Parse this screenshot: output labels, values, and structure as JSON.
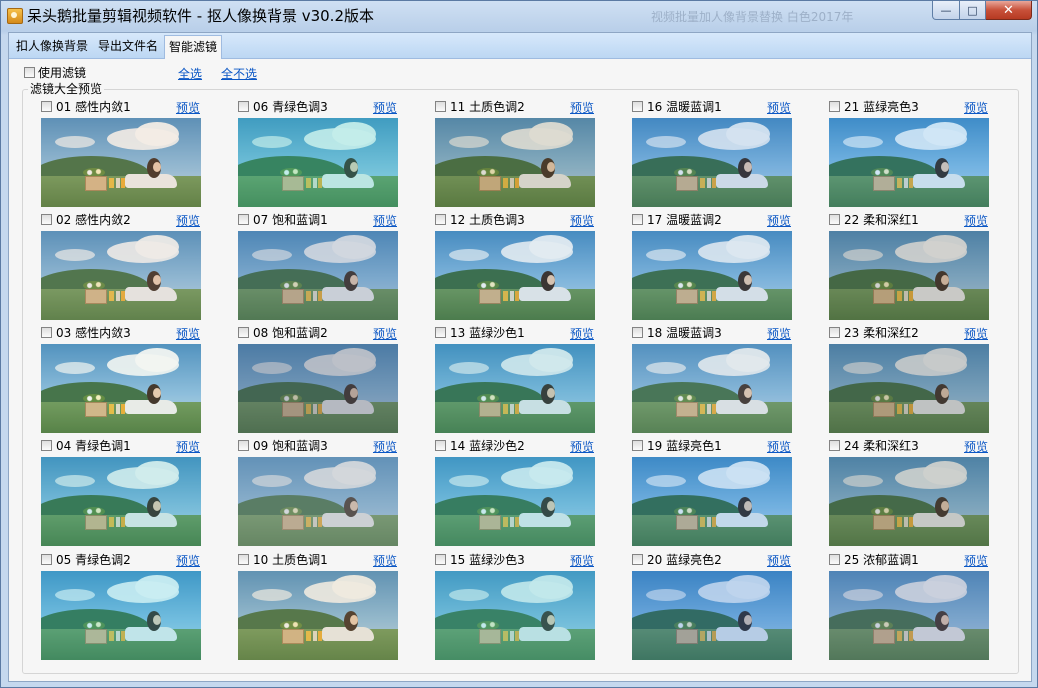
{
  "window": {
    "title": "呆头鹅批量剪辑视频软件 -  抠人像换背景  v30.2版本",
    "ghost_title": "视频批量加人像背景替换  白色2017年",
    "buttons": {
      "minimize": "—",
      "maximize": "□",
      "close": "✕"
    }
  },
  "tabs": [
    {
      "label": "扣人像换背景",
      "active": false
    },
    {
      "label": "导出文件名",
      "active": false
    },
    {
      "label": "智能滤镜",
      "active": true
    }
  ],
  "toolbar": {
    "use_filter_label": "使用滤镜",
    "use_filter_checked": false,
    "select_all": "全选",
    "deselect_all": "全不选"
  },
  "group_label": "滤镜大全预览",
  "preview_label": "预览",
  "filters": [
    {
      "name": "01 感性内敛1",
      "checked": false,
      "tint": "rgba(190,150,110,0.18)"
    },
    {
      "name": "02 感性内敛2",
      "checked": false,
      "tint": "rgba(170,150,130,0.20)"
    },
    {
      "name": "03 感性内敛3",
      "checked": false,
      "tint": "rgba(150,170,140,0.12)"
    },
    {
      "name": "04 青绿色调1",
      "checked": false,
      "tint": "rgba(40,170,170,0.22)"
    },
    {
      "name": "05 青绿色调2",
      "checked": false,
      "tint": "rgba(30,180,200,0.24)"
    },
    {
      "name": "06 青绿色调3",
      "checked": false,
      "tint": "rgba(40,190,180,0.28)"
    },
    {
      "name": "07 饱和蓝调1",
      "checked": false,
      "tint": "rgba(90,110,140,0.28)"
    },
    {
      "name": "08 饱和蓝调2",
      "checked": false,
      "tint": "rgba(80,90,110,0.38)"
    },
    {
      "name": "09 饱和蓝调3",
      "checked": false,
      "tint": "rgba(140,150,160,0.38)"
    },
    {
      "name": "10 土质色调1",
      "checked": false,
      "tint": "rgba(180,160,110,0.22)"
    },
    {
      "name": "11 土质色调2",
      "checked": false,
      "tint": "rgba(120,110,70,0.25)"
    },
    {
      "name": "12 土质色调3",
      "checked": false,
      "tint": "rgba(60,120,160,0.15)"
    },
    {
      "name": "13 蓝绿沙色1",
      "checked": false,
      "tint": "rgba(40,150,170,0.22)"
    },
    {
      "name": "14 蓝绿沙色2",
      "checked": false,
      "tint": "rgba(40,170,190,0.26)"
    },
    {
      "name": "15 蓝绿沙色3",
      "checked": false,
      "tint": "rgba(50,180,190,0.30)"
    },
    {
      "name": "16 温暖蓝调1",
      "checked": false,
      "tint": "rgba(40,110,180,0.20)"
    },
    {
      "name": "17 温暖蓝调2",
      "checked": false,
      "tint": "rgba(60,120,170,0.18)"
    },
    {
      "name": "18 温暖蓝调3",
      "checked": false,
      "tint": "rgba(120,150,170,0.22)"
    },
    {
      "name": "19 蓝绿亮色1",
      "checked": false,
      "tint": "rgba(20,120,200,0.22)"
    },
    {
      "name": "20 蓝绿亮色2",
      "checked": false,
      "tint": "rgba(20,100,190,0.28)"
    },
    {
      "name": "21 蓝绿亮色3",
      "checked": false,
      "tint": "rgba(20,130,210,0.20)"
    },
    {
      "name": "22 柔和深红1",
      "checked": false,
      "tint": "rgba(90,90,80,0.28)"
    },
    {
      "name": "23 柔和深红2",
      "checked": false,
      "tint": "rgba(80,90,90,0.32)"
    },
    {
      "name": "24 柔和深红3",
      "checked": false,
      "tint": "rgba(90,100,90,0.30)"
    },
    {
      "name": "25 浓郁蓝调1",
      "checked": false,
      "tint": "rgba(90,110,150,0.32)"
    }
  ]
}
